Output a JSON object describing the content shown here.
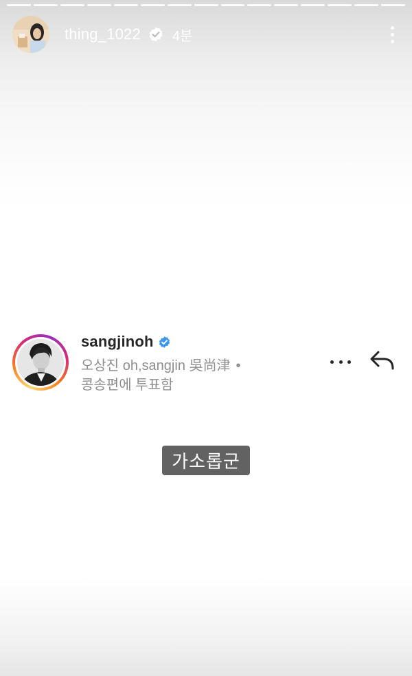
{
  "story": {
    "segment_count": 15,
    "header": {
      "username": "thing_1022",
      "verified": true,
      "time": "4분"
    },
    "colors": {
      "verified_blue": "#3897f0",
      "caption_bg": "#474747"
    }
  },
  "post": {
    "username": "sangjinoh",
    "verified": true,
    "meta_line1": "오상진 oh,sangjin 吳尚津",
    "meta_dot": "•",
    "meta_line2": "콩송편에 투표함",
    "icons": [
      "more-horizontal-icon",
      "reply-arrow-icon"
    ]
  },
  "caption": {
    "text": "가소롭군"
  }
}
